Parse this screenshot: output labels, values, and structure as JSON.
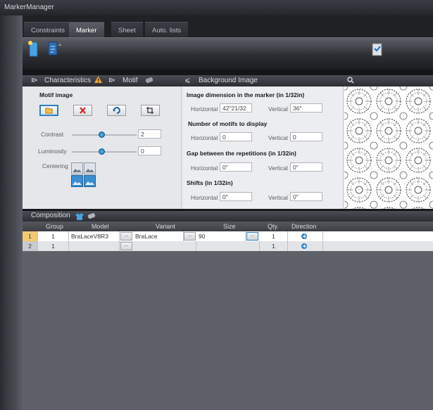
{
  "app": {
    "title": "MarkerManager"
  },
  "tabs": [
    {
      "label": "Constraints",
      "active": false
    },
    {
      "label": "Marker",
      "active": true
    },
    {
      "label": "Sheet",
      "active": false
    },
    {
      "label": "Auto. lists",
      "active": false
    }
  ],
  "panel_header": {
    "characteristics": "Characteristics",
    "motif": "Motif",
    "background_image": "Background Image"
  },
  "motif": {
    "heading": "Motif image",
    "contrast_label": "Contrast",
    "contrast_value": "2",
    "luminosity_label": "Luminosity",
    "luminosity_value": "0",
    "centering_label": "Centering"
  },
  "dimensions": {
    "image_dim_heading": "Image dimension in the marker (in 1/32in)",
    "image_h_label": "Horizontal",
    "image_h_value": "42\"21/32",
    "image_v_label": "Vertical",
    "image_v_value": "36\"",
    "motifs_heading": "Number of motifs to display",
    "motifs_h_label": "Horizontal",
    "motifs_h_value": "0",
    "motifs_v_label": "Vertical",
    "motifs_v_value": "0",
    "gap_heading": "Gap between the repetitions (in 1/32in)",
    "gap_h_label": "Horizontal",
    "gap_h_value": "0\"",
    "gap_v_label": "Vertical",
    "gap_v_value": "0\"",
    "shifts_heading": "Shifts (in 1/32in)",
    "shifts_h_label": "Horizontal",
    "shifts_h_value": "0\"",
    "shifts_v_label": "Vertical",
    "shifts_v_value": "0\""
  },
  "composition": {
    "title": "Composition",
    "columns": {
      "group": "Group",
      "model": "Model",
      "variant": "Variant",
      "size": "Size",
      "qty": "Qty.",
      "direction": "Direction"
    },
    "rows": [
      {
        "num": "1",
        "group": "1",
        "model": "BraLaceV8R3",
        "variant": "BraLace",
        "size": "90",
        "qty": "1",
        "ellipsis": "..."
      },
      {
        "num": "2",
        "group": "1",
        "model": "",
        "variant": "",
        "size": "",
        "qty": "1",
        "ellipsis": "..."
      }
    ]
  },
  "colors": {
    "accent": "#2d7fc1",
    "selected_row": "#ffffff",
    "row_num_selected": "#f2c873"
  }
}
